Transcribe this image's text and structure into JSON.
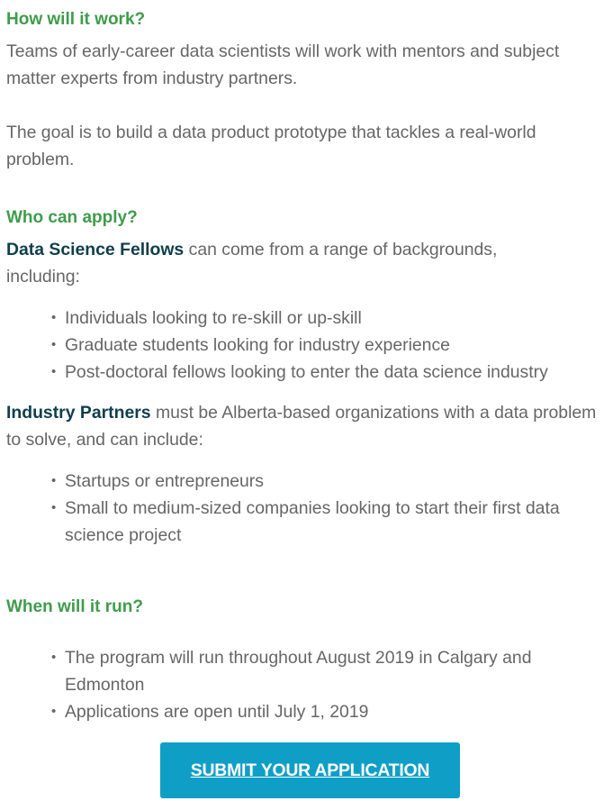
{
  "section_how": {
    "heading": "How will it work?",
    "para1": "Teams of early-career data scientists will work with mentors and subject matter experts from industry partners.",
    "para2": "The goal is to build a data product prototype that tackles a real-world problem."
  },
  "section_who": {
    "heading": "Who can apply?",
    "fellows_term": "Data Science Fellows",
    "fellows_text": " can come from a range of backgrounds, including:",
    "fellows_items": [
      "Individuals looking to re-skill or up-skill",
      "Graduate students looking for industry experience",
      "Post-doctoral fellows looking to enter the data science industry"
    ],
    "partners_term": "Industry Partners",
    "partners_text": " must be Alberta-based organizations with a data problem to solve, and can include:",
    "partners_items": [
      "Startups or entrepreneurs",
      "Small to medium-sized companies looking to start their first data science project"
    ]
  },
  "section_when": {
    "heading": "When will it run?",
    "items": [
      "The program will run throughout August 2019 in Calgary and Edmonton",
      "Applications are open until July 1, 2019"
    ]
  },
  "cta": {
    "label": "SUBMIT YOUR APPLICATION"
  }
}
